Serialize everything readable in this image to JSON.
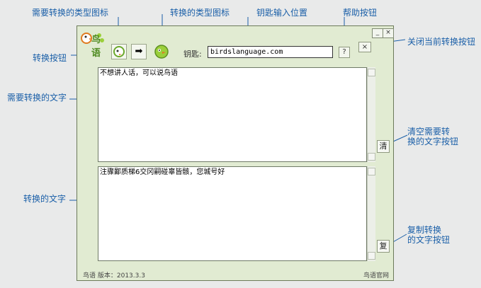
{
  "callouts": {
    "source_type_icon": "需要转换的类型图标",
    "target_type_icon": "转换的类型图标",
    "key_input_position": "钥匙输入位置",
    "help_button": "帮助按钮",
    "close_current": "关闭当前转换按钮",
    "convert_button": "转换按钮",
    "text_to_convert": "需要转换的文字",
    "clear_line1": "清空需要转",
    "clear_line2": "换的文字按钮",
    "converted_text": "转换的文字",
    "copy_line1": "复制转换",
    "copy_line2": "的文字按钮"
  },
  "window": {
    "logo_text": "鸟语",
    "minimize_label": "_",
    "close_label": "×",
    "convert_arrow": "➡",
    "key_label": "钥匙:",
    "key_value": "birdslanguage.com",
    "help_label": "?",
    "close_convert_label": "×",
    "input_text": "不想讲人话，可以说鸟语",
    "output_text": "注骤鄙质梯6交冈嗣碰辜皆骸，您城号好",
    "clear_button": "清",
    "copy_button": "复",
    "status_left": "鸟语  版本：2013.3.3",
    "status_right": "鸟语官网"
  },
  "colors": {
    "callout_text": "#1a5fa8",
    "window_bg": "#e1ebd2",
    "icon_green": "#9bcf3b"
  }
}
